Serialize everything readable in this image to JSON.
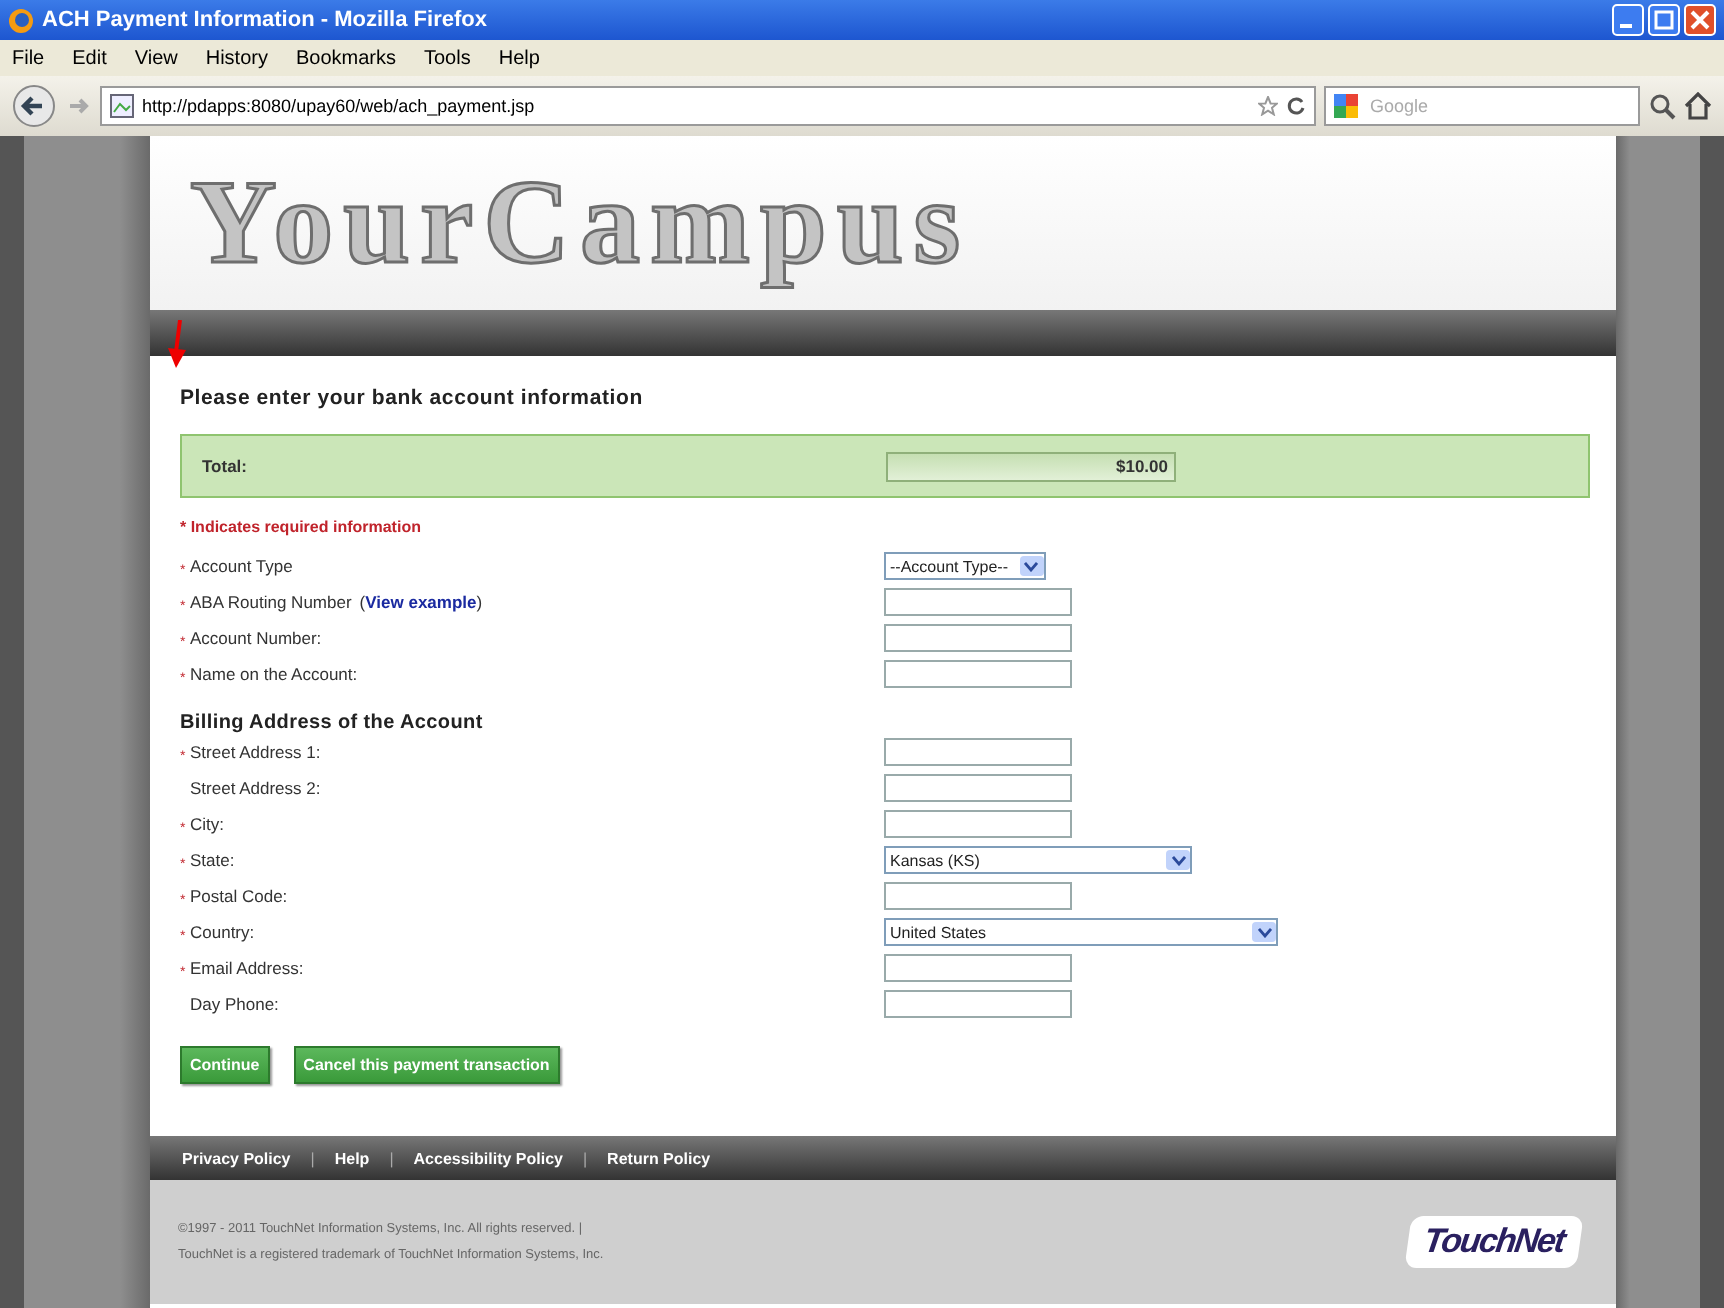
{
  "browser": {
    "title": "ACH Payment Information - Mozilla Firefox",
    "menu": [
      "File",
      "Edit",
      "View",
      "History",
      "Bookmarks",
      "Tools",
      "Help"
    ],
    "url": "http://pdapps:8080/upay60/web/ach_payment.jsp",
    "search_placeholder": "Google"
  },
  "banner": {
    "logo": "YourCampus"
  },
  "form": {
    "heading": "Please enter your bank account information",
    "total": {
      "label": "Total:",
      "value": "$10.00"
    },
    "required_note": "* Indicates required information",
    "required_mark": "*",
    "sections": [
      {
        "fields": [
          {
            "kind": "dropdown",
            "label": "Account Type",
            "required": true,
            "value": "--Account Type--"
          },
          {
            "kind": "text",
            "label": "ABA Routing Number",
            "required": true,
            "link": "View example",
            "link_open": "(",
            "link_close": ")"
          },
          {
            "kind": "text",
            "label": "Account Number:",
            "required": true
          },
          {
            "kind": "text",
            "label": "Name on the Account:",
            "required": true
          }
        ]
      },
      {
        "title": "Billing Address of the Account",
        "fields": [
          {
            "kind": "text",
            "label": "Street Address 1:",
            "required": true
          },
          {
            "kind": "text",
            "label": "Street Address 2:",
            "required": false
          },
          {
            "kind": "text",
            "label": "City:",
            "required": true
          },
          {
            "kind": "dropdown",
            "label": "State:",
            "required": true,
            "value": "Kansas (KS)"
          },
          {
            "kind": "text",
            "label": "Postal Code:",
            "required": true
          },
          {
            "kind": "dropdown",
            "label": "Country:",
            "required": true,
            "value": "United States"
          },
          {
            "kind": "text",
            "label": "Email Address:",
            "required": true
          },
          {
            "kind": "text",
            "label": "Day Phone:",
            "required": false
          }
        ]
      }
    ],
    "buttons": [
      "Continue",
      "Cancel this payment transaction"
    ]
  },
  "footer": {
    "links": [
      "Privacy Policy",
      "Help",
      "Accessibility Policy",
      "Return Policy"
    ],
    "separator": "|",
    "copyright": [
      "©1997 - 2011 TouchNet Information Systems, Inc. All rights reserved. |",
      "TouchNet is a registered trademark of TouchNet Information Systems, Inc."
    ],
    "logo": "TouchNet"
  }
}
